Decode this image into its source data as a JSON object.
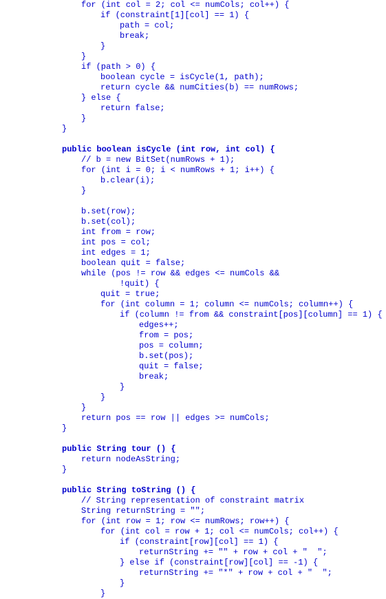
{
  "lines": [
    {
      "indent": 8,
      "text": "for (int col = 2; col <= numCols; col++) {"
    },
    {
      "indent": 12,
      "text": "if (constraint[1][col] == 1) {"
    },
    {
      "indent": 16,
      "text": "path = col;"
    },
    {
      "indent": 16,
      "text": "break;"
    },
    {
      "indent": 12,
      "text": "}"
    },
    {
      "indent": 8,
      "text": "}"
    },
    {
      "indent": 8,
      "text": "if (path > 0) {"
    },
    {
      "indent": 12,
      "text": "boolean cycle = isCycle(1, path);"
    },
    {
      "indent": 12,
      "text": "return cycle && numCities(b) == numRows;"
    },
    {
      "indent": 8,
      "text": "} else {"
    },
    {
      "indent": 12,
      "text": "return false;"
    },
    {
      "indent": 8,
      "text": "}"
    },
    {
      "indent": 4,
      "text": "}"
    },
    {
      "indent": 0,
      "text": ""
    },
    {
      "indent": 4,
      "text": "public boolean isCycle (int row, int col) {",
      "bold": true
    },
    {
      "indent": 8,
      "text": "// b = new BitSet(numRows + 1);"
    },
    {
      "indent": 8,
      "text": "for (int i = 0; i < numRows + 1; i++) {"
    },
    {
      "indent": 12,
      "text": "b.clear(i);"
    },
    {
      "indent": 8,
      "text": "}"
    },
    {
      "indent": 0,
      "text": ""
    },
    {
      "indent": 8,
      "text": "b.set(row);"
    },
    {
      "indent": 8,
      "text": "b.set(col);"
    },
    {
      "indent": 8,
      "text": "int from = row;"
    },
    {
      "indent": 8,
      "text": "int pos = col;"
    },
    {
      "indent": 8,
      "text": "int edges = 1;"
    },
    {
      "indent": 8,
      "text": "boolean quit = false;"
    },
    {
      "indent": 8,
      "text": "while (pos != row && edges <= numCols &&"
    },
    {
      "indent": 16,
      "text": "!quit) {"
    },
    {
      "indent": 12,
      "text": "quit = true;"
    },
    {
      "indent": 12,
      "text": "for (int column = 1; column <= numCols; column++) {"
    },
    {
      "indent": 16,
      "text": "if (column != from && constraint[pos][column] == 1) {"
    },
    {
      "indent": 20,
      "text": "edges++;"
    },
    {
      "indent": 20,
      "text": "from = pos;"
    },
    {
      "indent": 20,
      "text": "pos = column;"
    },
    {
      "indent": 20,
      "text": "b.set(pos);"
    },
    {
      "indent": 20,
      "text": "quit = false;"
    },
    {
      "indent": 20,
      "text": "break;"
    },
    {
      "indent": 16,
      "text": "}"
    },
    {
      "indent": 12,
      "text": "}"
    },
    {
      "indent": 8,
      "text": "}"
    },
    {
      "indent": 8,
      "text": "return pos == row || edges >= numCols;"
    },
    {
      "indent": 4,
      "text": "}"
    },
    {
      "indent": 0,
      "text": ""
    },
    {
      "indent": 4,
      "text": "public String tour () {",
      "bold": true
    },
    {
      "indent": 8,
      "text": "return nodeAsString;"
    },
    {
      "indent": 4,
      "text": "}"
    },
    {
      "indent": 0,
      "text": ""
    },
    {
      "indent": 4,
      "text": "public String toString () {",
      "bold": true
    },
    {
      "indent": 8,
      "text": "// String representation of constraint matrix"
    },
    {
      "indent": 8,
      "text": "String returnString = \"\";"
    },
    {
      "indent": 8,
      "text": "for (int row = 1; row <= numRows; row++) {"
    },
    {
      "indent": 12,
      "text": "for (int col = row + 1; col <= numCols; col++) {"
    },
    {
      "indent": 16,
      "text": "if (constraint[row][col] == 1) {"
    },
    {
      "indent": 20,
      "text": "returnString += \"\" + row + col + \"  \";"
    },
    {
      "indent": 16,
      "text": "} else if (constraint[row][col] == -1) {"
    },
    {
      "indent": 20,
      "text": "returnString += \"*\" + row + col + \"  \";"
    },
    {
      "indent": 16,
      "text": "}"
    },
    {
      "indent": 12,
      "text": "}"
    }
  ],
  "baseIndent": 62,
  "spaceWidth": 7
}
